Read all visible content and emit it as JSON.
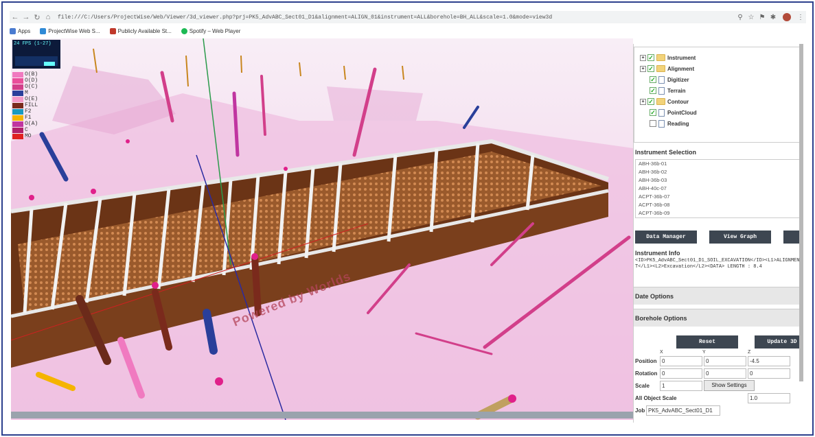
{
  "browser": {
    "url": "file:///C:/Users/ProjectWise/Web/Viewer/3d_viewer.php?prj=PK5_AdvABC_Sect01_D1&alignment=ALIGN_01&instrument=ALL&borehole=BH_ALL&scale=1.0&mode=view3d",
    "bookmarks": [
      {
        "label": "Apps",
        "color": "#4a7bd0"
      },
      {
        "label": "ProjectWise Web S...",
        "color": "#2f8ad6"
      },
      {
        "label": "Publicly Available St...",
        "color": "#c0392b"
      },
      {
        "label": "Spotify – Web Player",
        "color": "#1db954"
      }
    ]
  },
  "viewport": {
    "fps": "24 FPS (1-27)",
    "watermark": "Powered by Worlds",
    "legend": [
      {
        "label": "O(B)",
        "color": "#f07ac0"
      },
      {
        "label": "O(D)",
        "color": "#ea4f9b"
      },
      {
        "label": "O(C)",
        "color": "#d23f8a"
      },
      {
        "label": "M",
        "color": "#2a3f9a"
      },
      {
        "label": "O(E)",
        "color": "#f29ac8"
      },
      {
        "label": "FILL",
        "color": "#7a2a1c"
      },
      {
        "label": "F2",
        "color": "#1a9ac0"
      },
      {
        "label": "F1",
        "color": "#f5b400"
      },
      {
        "label": "O(A)",
        "color": "#c035a0"
      },
      {
        "label": "C",
        "color": "#b0206a"
      },
      {
        "label": "MO",
        "color": "#e02020"
      }
    ]
  },
  "tree": {
    "items": [
      {
        "label": "Instrument",
        "checked": true,
        "type": "folder",
        "expandable": true
      },
      {
        "label": "Alignment",
        "checked": true,
        "type": "folder",
        "expandable": true
      },
      {
        "label": "Digitizer",
        "checked": true,
        "type": "doc",
        "expandable": false
      },
      {
        "label": "Terrain",
        "checked": true,
        "type": "doc",
        "expandable": false
      },
      {
        "label": "Contour",
        "checked": true,
        "type": "folder",
        "expandable": true
      },
      {
        "label": "PointCloud",
        "checked": true,
        "type": "doc",
        "expandable": false
      },
      {
        "label": "Reading",
        "checked": false,
        "type": "doc",
        "expandable": false
      }
    ]
  },
  "instrument_selection": {
    "title": "Instrument Selection",
    "items": [
      "ABH-36b-01",
      "ABH-36b-02",
      "ABH-36b-03",
      "ABH-40c-07",
      "ACPT-36b-07",
      "ACPT-36b-08",
      "ACPT-36b-09"
    ]
  },
  "buttons": {
    "data_manager": "Data Manager",
    "view_graph": "View Graph",
    "reset": "Reset",
    "update": "Update 3D",
    "show_settings": "Show Settings"
  },
  "instrument_info": {
    "title": "Instrument Info",
    "text": "<ID>PK5_AdvABC_Sect01_D1_SOIL_EXCAVATION</ID><L1>ALIGNMENT</L1><L2>Excavation</L2><DATA> LENGTH : 8.4"
  },
  "sections": {
    "date_options": "Date Options",
    "borehole_options": "Borehole Options"
  },
  "transform": {
    "axes": [
      "X",
      "Y",
      "Z"
    ],
    "position_label": "Position",
    "position": [
      "0",
      "0",
      "-4.5"
    ],
    "rotation_label": "Rotation",
    "rotation": [
      "0",
      "0",
      "0"
    ],
    "scale_label": "Scale",
    "scale": "1",
    "all_object_scale_label": "All Object Scale",
    "all_object_scale": "1.0",
    "job_label": "Job",
    "job": "PK5_AdvABC_Sect01_D1"
  }
}
